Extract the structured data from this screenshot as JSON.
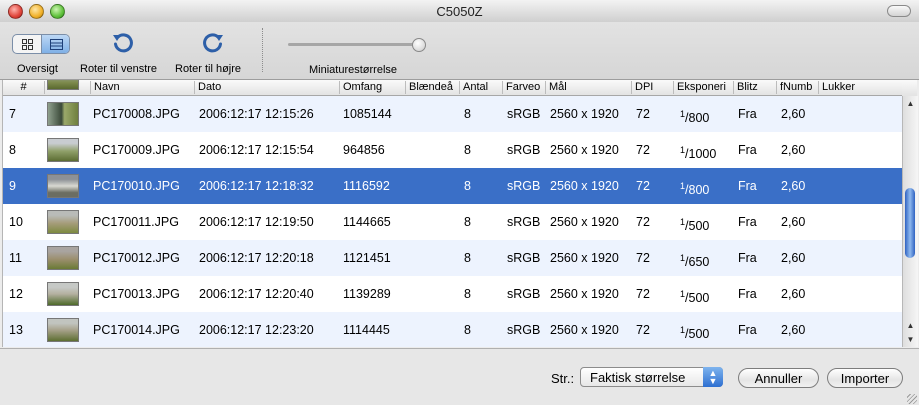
{
  "window": {
    "title": "C5050Z"
  },
  "toolbar": {
    "overview_label": "Oversigt",
    "rotate_left_label": "Roter til venstre",
    "rotate_right_label": "Roter til højre",
    "thumb_size_label": "Miniaturestørrelse"
  },
  "table": {
    "columns": [
      "#",
      "",
      "Navn",
      "Dato",
      "Omfang",
      "Blændeå",
      "Antal",
      "Farveo",
      "Mål",
      "DPI",
      "Eksponeri",
      "Blitz",
      "fNumb",
      "Lukker"
    ],
    "rows": [
      {
        "num": "7",
        "name": "PC170008.JPG",
        "date": "2006:12:17 12:15:26",
        "size": "1085144",
        "count": "8",
        "color": "sRGB",
        "dims": "2560 x 1920",
        "dpi": "72",
        "exp_num": "1",
        "exp_den": "800",
        "flash": "Fra",
        "fnum": "2,60"
      },
      {
        "num": "8",
        "name": "PC170009.JPG",
        "date": "2006:12:17 12:15:54",
        "size": "964856",
        "count": "8",
        "color": "sRGB",
        "dims": "2560 x 1920",
        "dpi": "72",
        "exp_num": "1",
        "exp_den": "1000",
        "flash": "Fra",
        "fnum": "2,60"
      },
      {
        "num": "9",
        "name": "PC170010.JPG",
        "date": "2006:12:17 12:18:32",
        "size": "1116592",
        "count": "8",
        "color": "sRGB",
        "dims": "2560 x 1920",
        "dpi": "72",
        "exp_num": "1",
        "exp_den": "800",
        "flash": "Fra",
        "fnum": "2,60"
      },
      {
        "num": "10",
        "name": "PC170011.JPG",
        "date": "2006:12:17 12:19:50",
        "size": "1144665",
        "count": "8",
        "color": "sRGB",
        "dims": "2560 x 1920",
        "dpi": "72",
        "exp_num": "1",
        "exp_den": "500",
        "flash": "Fra",
        "fnum": "2,60"
      },
      {
        "num": "11",
        "name": "PC170012.JPG",
        "date": "2006:12:17 12:20:18",
        "size": "1121451",
        "count": "8",
        "color": "sRGB",
        "dims": "2560 x 1920",
        "dpi": "72",
        "exp_num": "1",
        "exp_den": "650",
        "flash": "Fra",
        "fnum": "2,60"
      },
      {
        "num": "12",
        "name": "PC170013.JPG",
        "date": "2006:12:17 12:20:40",
        "size": "1139289",
        "count": "8",
        "color": "sRGB",
        "dims": "2560 x 1920",
        "dpi": "72",
        "exp_num": "1",
        "exp_den": "500",
        "flash": "Fra",
        "fnum": "2,60"
      },
      {
        "num": "13",
        "name": "PC170014.JPG",
        "date": "2006:12:17 12:23:20",
        "size": "1114445",
        "count": "8",
        "color": "sRGB",
        "dims": "2560 x 1920",
        "dpi": "72",
        "exp_num": "1",
        "exp_den": "500",
        "flash": "Fra",
        "fnum": "2,60"
      }
    ]
  },
  "bottom": {
    "size_label": "Str.:",
    "size_value": "Faktisk størrelse",
    "cancel_label": "Annuller",
    "import_label": "Importer"
  },
  "colors": {
    "selection": "#3a6fc7",
    "alt_row": "#edf3fe"
  }
}
